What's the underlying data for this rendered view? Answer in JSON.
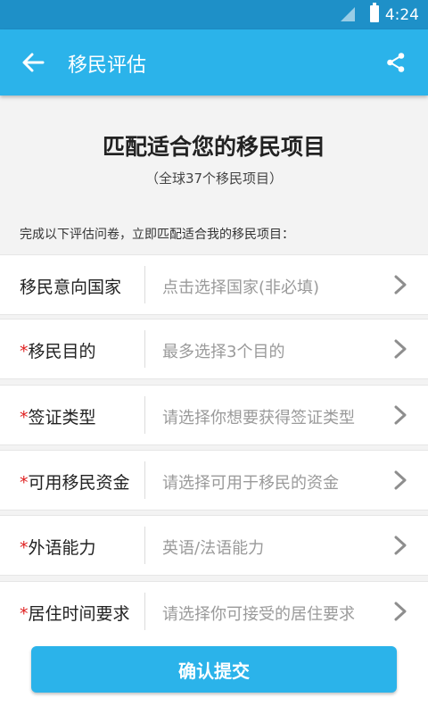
{
  "status": {
    "time": "4:24"
  },
  "header": {
    "title": "移民评估"
  },
  "intro": {
    "headline": "匹配适合您的移民项目",
    "subline": "（全球37个移民项目）",
    "prompt": "完成以下评估问卷，立即匹配适合我的移民项目："
  },
  "form": {
    "rows": [
      {
        "required": "",
        "label": "移民意向国家",
        "value": "点击选择国家(非必填)"
      },
      {
        "required": "*",
        "label": "移民目的",
        "value": "最多选择3个目的"
      },
      {
        "required": "*",
        "label": "签证类型",
        "value": "请选择你想要获得签证类型"
      },
      {
        "required": "*",
        "label": "可用移民资金",
        "value": "请选择可用于移民的资金"
      },
      {
        "required": "*",
        "label": "外语能力",
        "value": "英语/法语能力"
      },
      {
        "required": "*",
        "label": "居住时间要求",
        "value": "请选择你可接受的居住要求"
      }
    ]
  },
  "footer": {
    "submit_label": "确认提交"
  },
  "colors": {
    "accent": "#2bb3ea",
    "status_bar": "#1e90c8",
    "required": "#e02020"
  },
  "icons": {
    "back": "arrow-left-icon",
    "share": "share-icon",
    "chevron": "chevron-right-icon"
  }
}
